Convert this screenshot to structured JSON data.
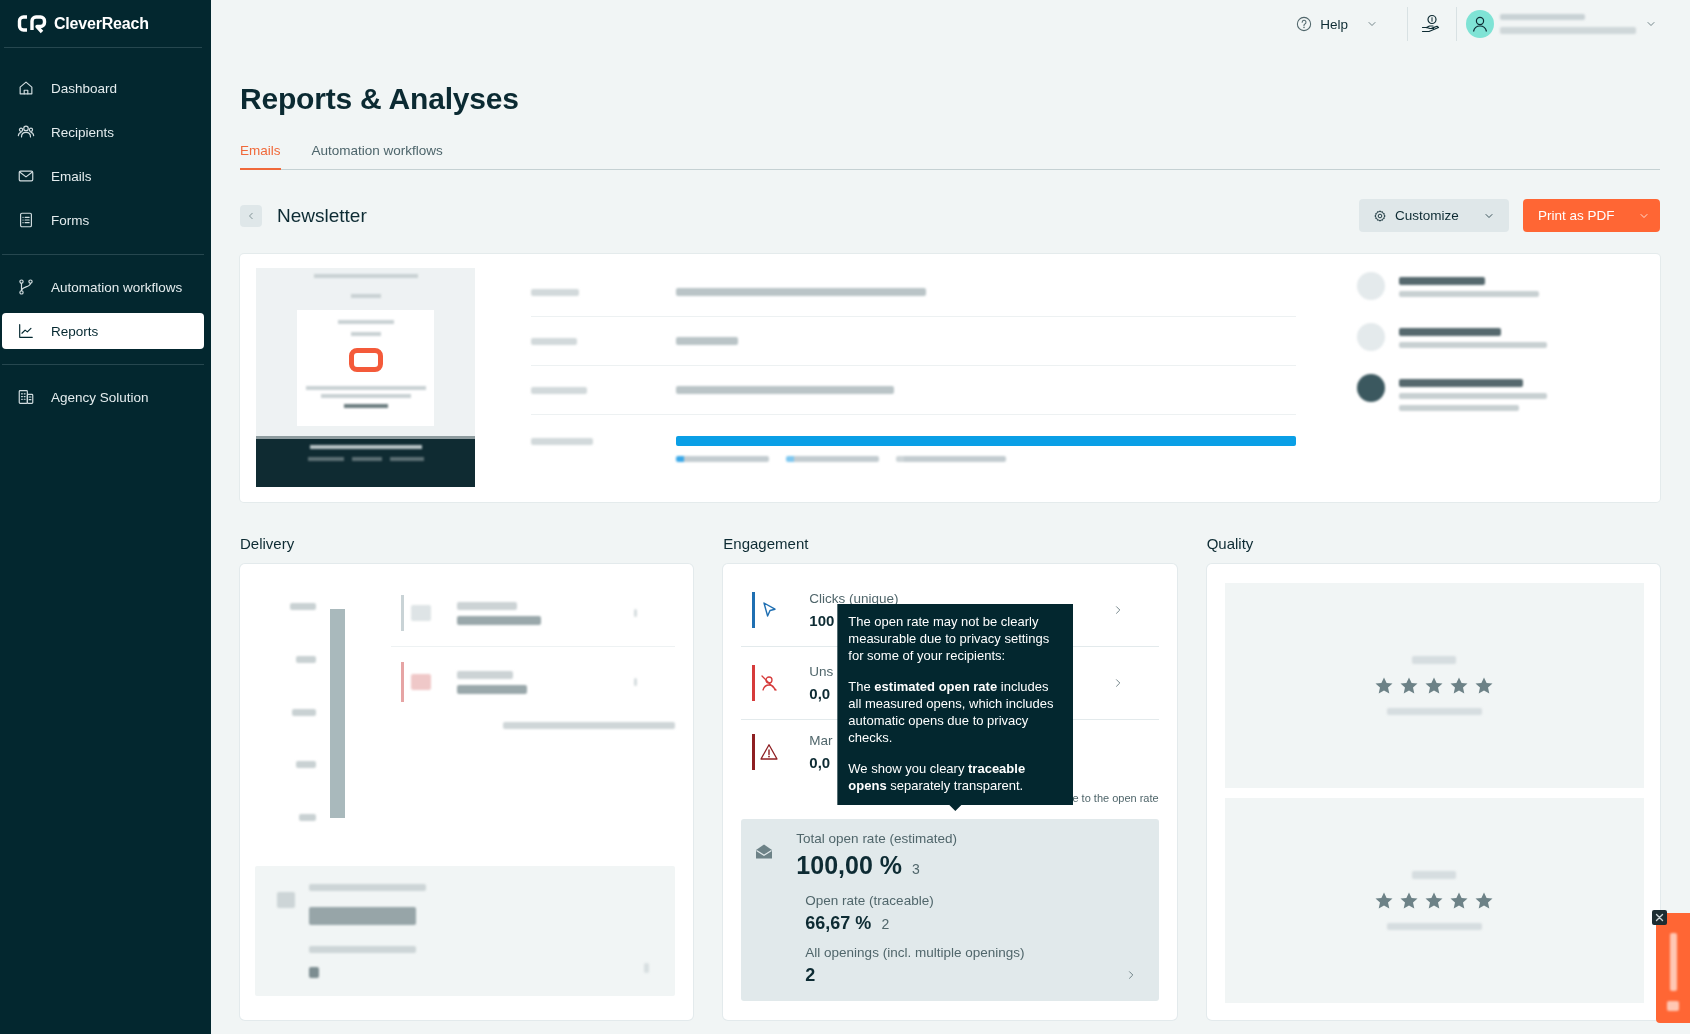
{
  "sidebar": {
    "logo": "CleverReach",
    "groups": [
      {
        "items": [
          {
            "label": "Dashboard",
            "kind": "home",
            "selected": false
          },
          {
            "label": "Recipients",
            "kind": "people",
            "selected": false
          },
          {
            "label": "Emails",
            "kind": "mail",
            "selected": false
          },
          {
            "label": "Forms",
            "kind": "form",
            "selected": false
          }
        ]
      },
      {
        "items": [
          {
            "label": "Automation workflows",
            "kind": "workflow",
            "selected": false
          },
          {
            "label": "Reports",
            "kind": "chart",
            "selected": true
          }
        ]
      },
      {
        "items": [
          {
            "label": "Agency Solution",
            "kind": "building",
            "selected": false
          }
        ]
      }
    ]
  },
  "topbar": {
    "help": "Help"
  },
  "page": {
    "title": "Reports & Analyses",
    "tabs": [
      {
        "label": "Emails",
        "selected": true
      },
      {
        "label": "Automation workflows",
        "selected": false
      }
    ]
  },
  "report": {
    "name": "Newsletter",
    "buttons": [
      {
        "label": "Customize",
        "kind": "secondary"
      },
      {
        "label": "Print as PDF",
        "kind": "primary"
      }
    ]
  },
  "summary": {
    "progress": {
      "level": 1
    }
  },
  "delivery": {
    "title": "Delivery",
    "rows": [
      {
        "color": "#c9d3d6"
      },
      {
        "color": "#e6a4a4"
      }
    ]
  },
  "engagement": {
    "title": "Engagement",
    "metrics": [
      {
        "kind": "clicks",
        "label": "Clicks (unique)",
        "value": "100",
        "color": "#1f6fb2",
        "chevron": true
      },
      {
        "kind": "unsubscribes",
        "label": "Uns",
        "value": "0,0",
        "color": "#d63b3b",
        "chevron": true
      },
      {
        "kind": "spam",
        "label": "Mar",
        "value": "0,0",
        "color": "#8e1f22",
        "chevron": false
      }
    ],
    "footnote": "e to the open rate",
    "open_rate": {
      "label": "Total open rate (estimated)",
      "value": "100,00 %",
      "count": "3",
      "details": [
        {
          "label": "Open rate (traceable)",
          "value": "66,67 %",
          "count": "2",
          "chevron": false
        },
        {
          "label": "All openings (incl. multiple openings)",
          "value": "2",
          "chevron": true
        }
      ]
    },
    "tooltip": {
      "paragraphs": [
        "The open rate may not be clearly measurable due to privacy settings for some of your recipients:",
        "The **estimated open rate** includes all measured opens, which includes automatic opens due to privacy checks.",
        "We show you cleary **traceable opens** separately transparent."
      ]
    }
  },
  "quality": {
    "title": "Quality",
    "ratings": [
      {
        "stars": 5
      },
      {
        "stars": 5
      }
    ]
  }
}
